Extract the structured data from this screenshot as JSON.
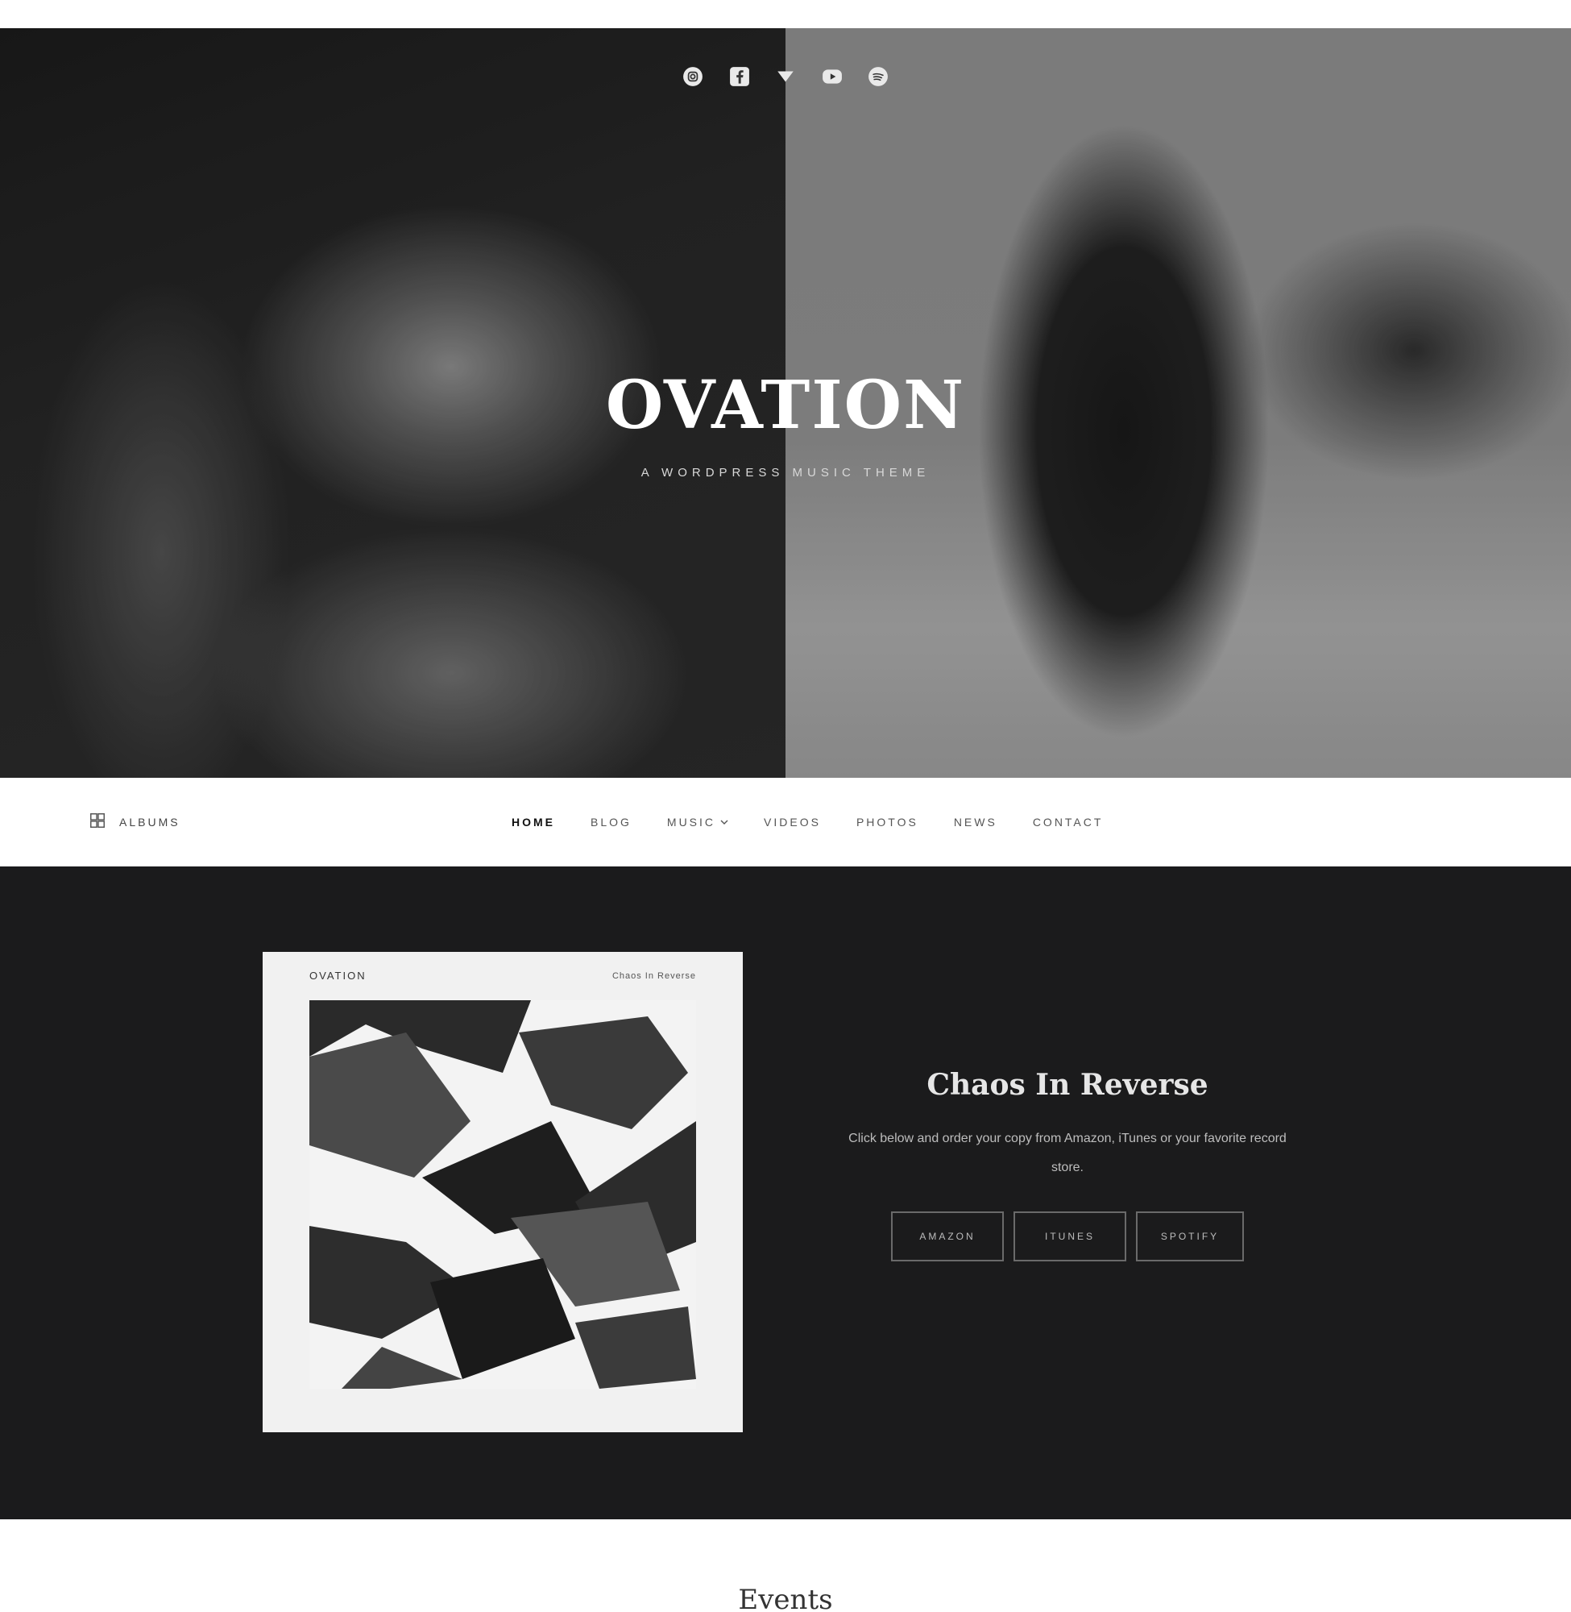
{
  "hero": {
    "social_icons": [
      "instagram-icon",
      "facebook-icon",
      "twitter-icon",
      "youtube-icon",
      "spotify-icon"
    ],
    "site_title": "OVATION",
    "tagline": "A Wordpress Music Theme"
  },
  "nav": {
    "albums_label": "Albums",
    "items": [
      {
        "label": "Home",
        "active": true
      },
      {
        "label": "Blog"
      },
      {
        "label": "Music",
        "has_dropdown": true
      },
      {
        "label": "Videos"
      },
      {
        "label": "Photos"
      },
      {
        "label": "News"
      },
      {
        "label": "Contact"
      }
    ]
  },
  "release": {
    "cover_artist": "Ovation",
    "cover_title": "Chaos In Reverse",
    "title": "Chaos In Reverse",
    "description": "Click below and order your copy from Amazon, iTunes or your favorite record store.",
    "buttons": [
      "Amazon",
      "iTunes",
      "Spotify"
    ]
  },
  "next_section": {
    "heading": "Events"
  },
  "colors": {
    "dark_section": "#1b1b1c",
    "accent_text": "#e6e6e6"
  }
}
